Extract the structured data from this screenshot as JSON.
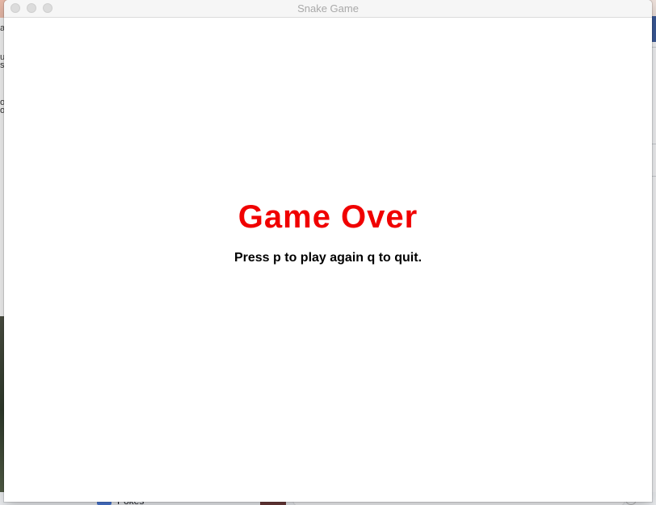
{
  "window": {
    "title": "Snake Game"
  },
  "game": {
    "headline": "Game Over",
    "instructions": "Press p to play again q to quit."
  },
  "background": {
    "taskbar_label": "Pokes"
  },
  "colors": {
    "headline": "#f00000",
    "instructions": "#000000",
    "canvas": "#ffffff"
  }
}
